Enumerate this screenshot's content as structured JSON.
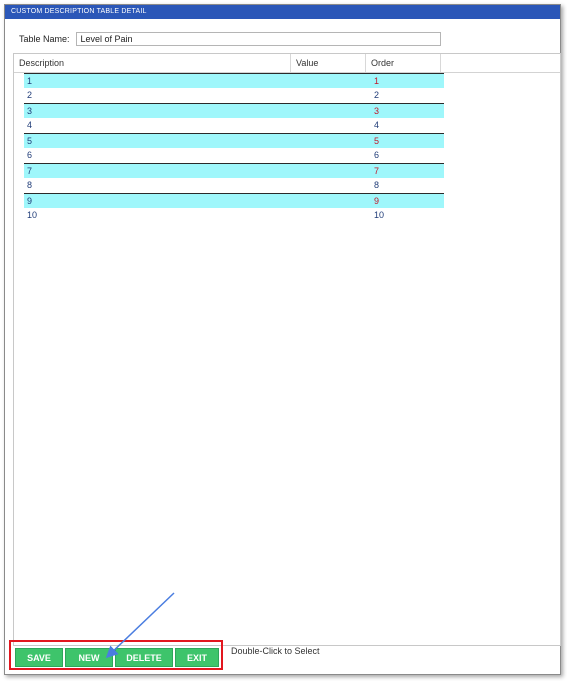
{
  "window": {
    "title": "CUSTOM DESCRIPTION TABLE DETAIL"
  },
  "form": {
    "table_name_label": "Table Name:",
    "table_name_value": "Level of Pain"
  },
  "grid": {
    "columns": [
      "Description",
      "Value",
      "Order"
    ],
    "rows": [
      {
        "description": "1",
        "value": "",
        "order": "1",
        "highlighted": true
      },
      {
        "description": "2",
        "value": "",
        "order": "2",
        "highlighted": false
      },
      {
        "description": "3",
        "value": "",
        "order": "3",
        "highlighted": true
      },
      {
        "description": "4",
        "value": "",
        "order": "4",
        "highlighted": false
      },
      {
        "description": "5",
        "value": "",
        "order": "5",
        "highlighted": true
      },
      {
        "description": "6",
        "value": "",
        "order": "6",
        "highlighted": false
      },
      {
        "description": "7",
        "value": "",
        "order": "7",
        "highlighted": true
      },
      {
        "description": "8",
        "value": "",
        "order": "8",
        "highlighted": false
      },
      {
        "description": "9",
        "value": "",
        "order": "9",
        "highlighted": true
      },
      {
        "description": "10",
        "value": "",
        "order": "10",
        "highlighted": false
      }
    ]
  },
  "buttons": {
    "save": "SAVE",
    "new": "NEW",
    "delete": "DELETE",
    "exit": "EXIT"
  },
  "hint": "Double-Click to Select",
  "colors": {
    "titlebar": "#2b57b8",
    "row_highlight": "#9ff7fb",
    "button": "#3ec46b",
    "annotation_box": "#e2161e",
    "arrow": "#4a7de0"
  }
}
